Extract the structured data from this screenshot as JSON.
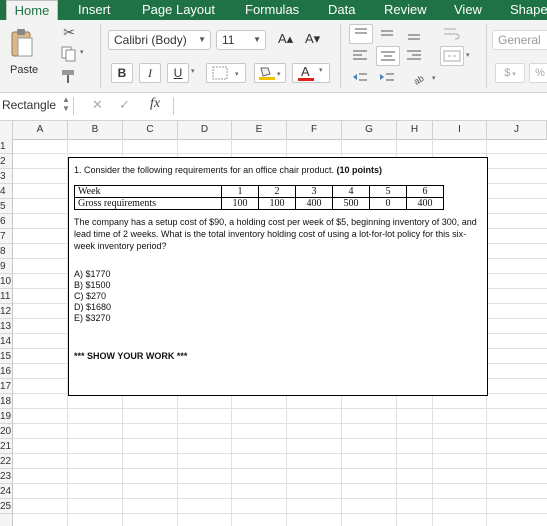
{
  "tabs": [
    "Home",
    "Insert",
    "Page Layout",
    "Formulas",
    "Data",
    "Review",
    "View",
    "Shape"
  ],
  "ribbon": {
    "paste_label": "Paste",
    "font_name": "Calibri (Body)",
    "font_size": "11",
    "bold": "B",
    "italic": "I",
    "underline": "U",
    "grow_font": "A▴",
    "shrink_font": "A▾",
    "font_color_letter": "A",
    "number_format": "General",
    "currency_symbol": "$",
    "percent_symbol": "%"
  },
  "formula_bar": {
    "name_box": "Rectangle",
    "fx": "fx",
    "cancel": "✕",
    "enter": "✓"
  },
  "columns": [
    "A",
    "B",
    "C",
    "D",
    "E",
    "F",
    "G",
    "H",
    "I",
    "J"
  ],
  "rows": [
    "1",
    "2",
    "3",
    "4",
    "5",
    "6",
    "7",
    "8",
    "9",
    "10",
    "11",
    "12",
    "13",
    "14",
    "15",
    "16",
    "17",
    "18",
    "19",
    "20",
    "21",
    "22",
    "23",
    "24",
    "25"
  ],
  "question": {
    "title": "1. Consider the following requirements for an office chair product.",
    "points": "(10 points)",
    "table": {
      "row1_label": "Week",
      "row1_values": [
        "1",
        "2",
        "3",
        "4",
        "5",
        "6"
      ],
      "row2_label": "Gross requirements",
      "row2_values": [
        "100",
        "100",
        "400",
        "500",
        "0",
        "400"
      ]
    },
    "paragraph": "The company has a setup cost of $90, a holding cost per week of $5, beginning inventory of 300, and lead time of 2 weeks. What is the total inventory holding cost of using a lot-for-lot policy for this six-week inventory period?",
    "options": [
      "A) $1770",
      "B) $1500",
      "C) $270",
      "D) $1680",
      "E) $3270"
    ],
    "show_work": "*** SHOW YOUR WORK ***"
  }
}
